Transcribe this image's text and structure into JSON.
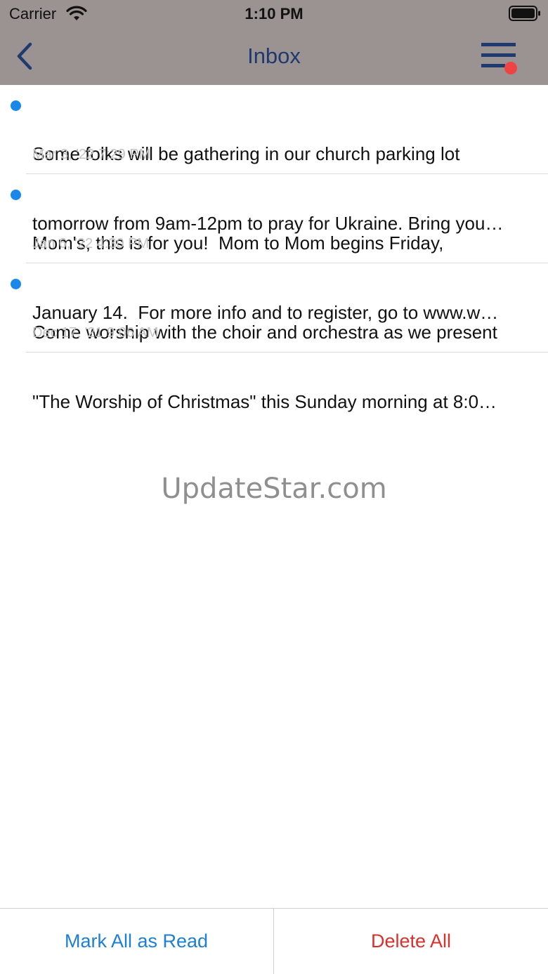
{
  "status": {
    "carrier": "Carrier",
    "time": "1:10 PM",
    "wifi_icon": "wifi-icon",
    "battery_icon": "battery-icon"
  },
  "nav": {
    "title": "Inbox",
    "back_icon": "chevron-left-icon",
    "menu_icon": "menu-icon",
    "menu_badge_color": "#f04444",
    "title_color": "#1f3a6e",
    "bar_color": "#9b9292"
  },
  "messages": [
    {
      "line1": "Some folks will be gathering in our church parking lot",
      "line2": "tomorrow from 9am-12pm to pray for Ukraine. Bring you…",
      "date": "Mar 3, '22 7:29 PM",
      "unread": true
    },
    {
      "line1": "Mom's, this is for you!  Mom to Mom begins Friday,",
      "line2": "January 14.  For more info and to register, go to www.w…",
      "date": "Jan 6, '22 4:30 PM",
      "unread": true
    },
    {
      "line1": "Come worship with the choir and orchestra as we present",
      "line2": "\"The Worship of Christmas\" this Sunday morning at 8:0…",
      "date": "Dec 17, '21 9:06 AM",
      "unread": true
    }
  ],
  "watermark": "UpdateStar.com",
  "actions": {
    "mark_all_read": "Mark All as Read",
    "delete_all": "Delete All",
    "mark_color": "#1c7fd6",
    "delete_color": "#d9302c"
  }
}
